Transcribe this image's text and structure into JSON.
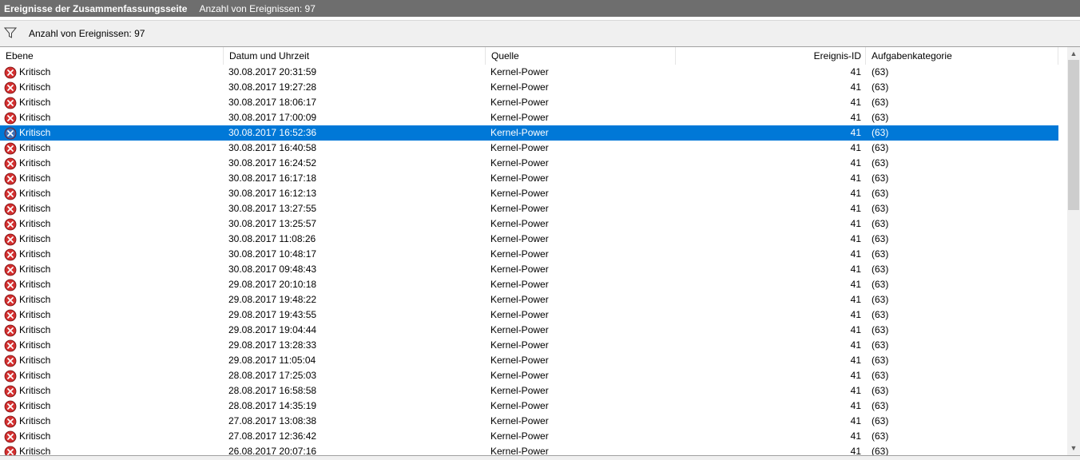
{
  "title": {
    "main": "Ereignisse der Zusammenfassungsseite",
    "count": "Anzahl von Ereignissen: 97"
  },
  "toolbar": {
    "icon": "filter-icon",
    "count_text": "Anzahl von Ereignissen: 97"
  },
  "columns": [
    "Ebene",
    "Datum und Uhrzeit",
    "Quelle",
    "Ereignis-ID",
    "Aufgabenkategorie"
  ],
  "colors": {
    "critical": "#d32f2f",
    "selection": "#0078d7",
    "titlebar": "#6e6e6e"
  },
  "rows": [
    {
      "level": "Kritisch",
      "date": "30.08.2017 20:31:59",
      "source": "Kernel-Power",
      "id": "41",
      "category": "(63)"
    },
    {
      "level": "Kritisch",
      "date": "30.08.2017 19:27:28",
      "source": "Kernel-Power",
      "id": "41",
      "category": "(63)"
    },
    {
      "level": "Kritisch",
      "date": "30.08.2017 18:06:17",
      "source": "Kernel-Power",
      "id": "41",
      "category": "(63)"
    },
    {
      "level": "Kritisch",
      "date": "30.08.2017 17:00:09",
      "source": "Kernel-Power",
      "id": "41",
      "category": "(63)"
    },
    {
      "level": "Kritisch",
      "date": "30.08.2017 16:52:36",
      "source": "Kernel-Power",
      "id": "41",
      "category": "(63)",
      "selected": true
    },
    {
      "level": "Kritisch",
      "date": "30.08.2017 16:40:58",
      "source": "Kernel-Power",
      "id": "41",
      "category": "(63)"
    },
    {
      "level": "Kritisch",
      "date": "30.08.2017 16:24:52",
      "source": "Kernel-Power",
      "id": "41",
      "category": "(63)"
    },
    {
      "level": "Kritisch",
      "date": "30.08.2017 16:17:18",
      "source": "Kernel-Power",
      "id": "41",
      "category": "(63)"
    },
    {
      "level": "Kritisch",
      "date": "30.08.2017 16:12:13",
      "source": "Kernel-Power",
      "id": "41",
      "category": "(63)"
    },
    {
      "level": "Kritisch",
      "date": "30.08.2017 13:27:55",
      "source": "Kernel-Power",
      "id": "41",
      "category": "(63)"
    },
    {
      "level": "Kritisch",
      "date": "30.08.2017 13:25:57",
      "source": "Kernel-Power",
      "id": "41",
      "category": "(63)"
    },
    {
      "level": "Kritisch",
      "date": "30.08.2017 11:08:26",
      "source": "Kernel-Power",
      "id": "41",
      "category": "(63)"
    },
    {
      "level": "Kritisch",
      "date": "30.08.2017 10:48:17",
      "source": "Kernel-Power",
      "id": "41",
      "category": "(63)"
    },
    {
      "level": "Kritisch",
      "date": "30.08.2017 09:48:43",
      "source": "Kernel-Power",
      "id": "41",
      "category": "(63)"
    },
    {
      "level": "Kritisch",
      "date": "29.08.2017 20:10:18",
      "source": "Kernel-Power",
      "id": "41",
      "category": "(63)"
    },
    {
      "level": "Kritisch",
      "date": "29.08.2017 19:48:22",
      "source": "Kernel-Power",
      "id": "41",
      "category": "(63)"
    },
    {
      "level": "Kritisch",
      "date": "29.08.2017 19:43:55",
      "source": "Kernel-Power",
      "id": "41",
      "category": "(63)"
    },
    {
      "level": "Kritisch",
      "date": "29.08.2017 19:04:44",
      "source": "Kernel-Power",
      "id": "41",
      "category": "(63)"
    },
    {
      "level": "Kritisch",
      "date": "29.08.2017 13:28:33",
      "source": "Kernel-Power",
      "id": "41",
      "category": "(63)"
    },
    {
      "level": "Kritisch",
      "date": "29.08.2017 11:05:04",
      "source": "Kernel-Power",
      "id": "41",
      "category": "(63)"
    },
    {
      "level": "Kritisch",
      "date": "28.08.2017 17:25:03",
      "source": "Kernel-Power",
      "id": "41",
      "category": "(63)"
    },
    {
      "level": "Kritisch",
      "date": "28.08.2017 16:58:58",
      "source": "Kernel-Power",
      "id": "41",
      "category": "(63)"
    },
    {
      "level": "Kritisch",
      "date": "28.08.2017 14:35:19",
      "source": "Kernel-Power",
      "id": "41",
      "category": "(63)"
    },
    {
      "level": "Kritisch",
      "date": "27.08.2017 13:08:38",
      "source": "Kernel-Power",
      "id": "41",
      "category": "(63)"
    },
    {
      "level": "Kritisch",
      "date": "27.08.2017 12:36:42",
      "source": "Kernel-Power",
      "id": "41",
      "category": "(63)"
    },
    {
      "level": "Kritisch",
      "date": "26.08.2017 20:07:16",
      "source": "Kernel-Power",
      "id": "41",
      "category": "(63)"
    }
  ]
}
